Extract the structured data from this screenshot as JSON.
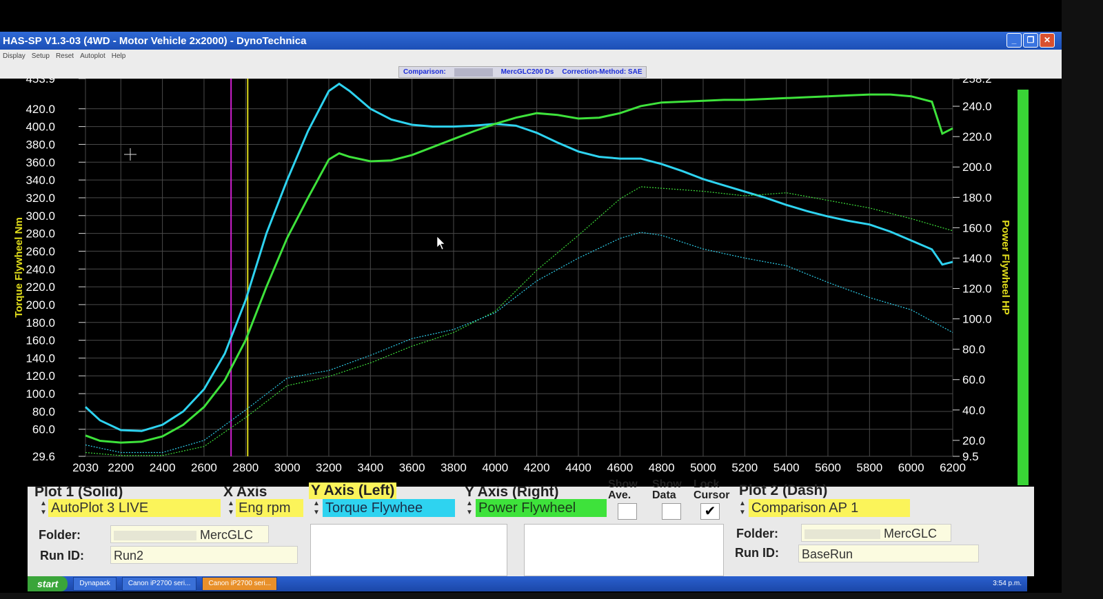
{
  "window": {
    "title": "HAS-SP V1.3-03  (4WD - Motor Vehicle 2x2000) - DynoTechnica",
    "menu": [
      "Display",
      "Setup",
      "Reset",
      "Autoplot",
      "Help"
    ],
    "controls": [
      "_",
      "❐",
      "✕"
    ]
  },
  "infobar": {
    "comparison_label": "Comparison:",
    "comparison_value": "MercGLC200 Ds",
    "correction_label": "Correction-Method: SAE"
  },
  "chart_data": {
    "type": "line",
    "xlim": [
      2030,
      6200
    ],
    "ylim_left": [
      29.6,
      453.9
    ],
    "ylim_right": [
      9.5,
      258.2
    ],
    "grid": true,
    "ylabel_left": "Torque Flywheel Nm",
    "ylabel_right": "Power Flywheel HP",
    "x_ticks": [
      2030,
      2200,
      2400,
      2600,
      2800,
      3000,
      3200,
      3400,
      3600,
      3800,
      4000,
      4200,
      4400,
      4600,
      4800,
      5000,
      5200,
      5400,
      5600,
      5800,
      6000,
      6200
    ],
    "y_left_ticks": [
      "453.9",
      "420.0",
      "400.0",
      "380.0",
      "360.0",
      "340.0",
      "320.0",
      "300.0",
      "280.0",
      "260.0",
      "240.0",
      "220.0",
      "200.0",
      "180.0",
      "160.0",
      "140.0",
      "120.0",
      "100.0",
      "80.0",
      "60.0",
      "29.6"
    ],
    "y_right_ticks": [
      "258.2",
      "240.0",
      "220.0",
      "200.0",
      "180.0",
      "160.0",
      "140.0",
      "120.0",
      "100.0",
      "80.0",
      "60.0",
      "40.0",
      "20.0",
      "9.5"
    ],
    "cursors": [
      {
        "x": 2730,
        "color": "#d21fd2"
      },
      {
        "x": 2810,
        "color": "#e3df1c"
      }
    ],
    "series": [
      {
        "axis": "left",
        "style": "solid",
        "color": "#2ed3f0",
        "x": [
          2030,
          2100,
          2200,
          2300,
          2400,
          2500,
          2600,
          2700,
          2800,
          2900,
          3000,
          3100,
          3200,
          3250,
          3300,
          3400,
          3500,
          3600,
          3700,
          3800,
          3900,
          4000,
          4100,
          4200,
          4300,
          4400,
          4500,
          4600,
          4700,
          4800,
          4900,
          5000,
          5100,
          5200,
          5300,
          5400,
          5500,
          5600,
          5700,
          5800,
          5900,
          6000,
          6100,
          6150,
          6200
        ],
        "y": [
          85,
          70,
          59,
          58,
          65,
          80,
          105,
          145,
          205,
          280,
          340,
          395,
          440,
          448,
          440,
          420,
          408,
          402,
          400,
          400,
          401,
          403,
          401,
          393,
          382,
          372,
          366,
          364,
          364,
          358,
          350,
          341,
          334,
          327,
          320,
          312,
          305,
          299,
          294,
          290,
          282,
          272,
          262,
          245,
          248
        ]
      },
      {
        "axis": "left",
        "style": "solid",
        "color": "#3ee23b",
        "x": [
          2030,
          2100,
          2200,
          2300,
          2400,
          2500,
          2600,
          2700,
          2800,
          2900,
          3000,
          3100,
          3200,
          3250,
          3300,
          3400,
          3500,
          3600,
          3700,
          3800,
          3900,
          4000,
          4100,
          4200,
          4300,
          4400,
          4500,
          4600,
          4700,
          4800,
          4900,
          5000,
          5100,
          5200,
          5300,
          5400,
          5500,
          5600,
          5700,
          5800,
          5900,
          6000,
          6100,
          6150,
          6200
        ],
        "y": [
          53,
          47,
          45,
          46,
          52,
          65,
          85,
          115,
          160,
          220,
          275,
          320,
          363,
          370,
          366,
          361,
          362,
          368,
          377,
          386,
          395,
          403,
          410,
          415,
          413,
          409,
          410,
          415,
          423,
          427,
          428,
          429,
          430,
          430,
          431,
          432,
          433,
          434,
          435,
          436,
          436,
          434,
          428,
          392,
          398
        ]
      },
      {
        "axis": "right",
        "style": "dash",
        "color": "#3ee23b",
        "x": [
          2030,
          2200,
          2400,
          2600,
          2800,
          3000,
          3200,
          3400,
          3600,
          3800,
          4000,
          4200,
          4400,
          4600,
          4700,
          4800,
          5000,
          5200,
          5400,
          5600,
          5800,
          6000,
          6200
        ],
        "y": [
          12,
          10,
          10,
          16,
          35,
          56,
          62,
          71,
          82,
          91,
          105,
          132,
          155,
          179,
          187,
          186,
          184,
          181,
          183,
          178,
          173,
          166,
          158
        ]
      },
      {
        "axis": "right",
        "style": "dash",
        "color": "#2ed3f0",
        "x": [
          2030,
          2200,
          2400,
          2600,
          2800,
          3000,
          3200,
          3400,
          3600,
          3800,
          4000,
          4200,
          4400,
          4600,
          4700,
          4800,
          5000,
          5200,
          5400,
          5600,
          5800,
          6000,
          6200
        ],
        "y": [
          17,
          12,
          12,
          20,
          40,
          61,
          66,
          76,
          87,
          93,
          104,
          125,
          140,
          153,
          157,
          155,
          146,
          140,
          135,
          124,
          114,
          106,
          91
        ]
      }
    ]
  },
  "panel": {
    "plot1_label": "Plot 1 (Solid)",
    "plot1_value": "AutoPlot 3 LIVE",
    "xaxis_label": "X Axis",
    "xaxis_value": "Eng rpm",
    "yleft_label": "Y Axis (Left)",
    "yleft_value": "Torque Flywhee",
    "yright_label": "Y Axis (Right)",
    "yright_value": "Power Flywheel",
    "show_label": "Show",
    "ave_label": "Ave.",
    "show2_label": "Show",
    "data_label": "Data",
    "lock_label": "Lock",
    "cursor_label": "Cursor",
    "lock_cursor_check": "✔",
    "plot2_label": "Plot 2 (Dash)",
    "plot2_value": "Comparison AP 1",
    "folder_label": "Folder:",
    "folder1_value": "MercGLC",
    "runid_label": "Run ID:",
    "runid1_value": "Run2",
    "folder2_value": "MercGLC",
    "runid2_value": "BaseRun"
  },
  "taskbar": {
    "start": "start",
    "tasks": [
      "Dynapack",
      "Canon iP2700 seri...",
      "Canon iP2700 seri..."
    ],
    "clock": "3:54 p.m."
  },
  "colors": {
    "torque": "#2ed3f0",
    "power": "#3ee23b",
    "highlight_yellow": "#fbf45a",
    "grid": "#4a4a4a"
  }
}
